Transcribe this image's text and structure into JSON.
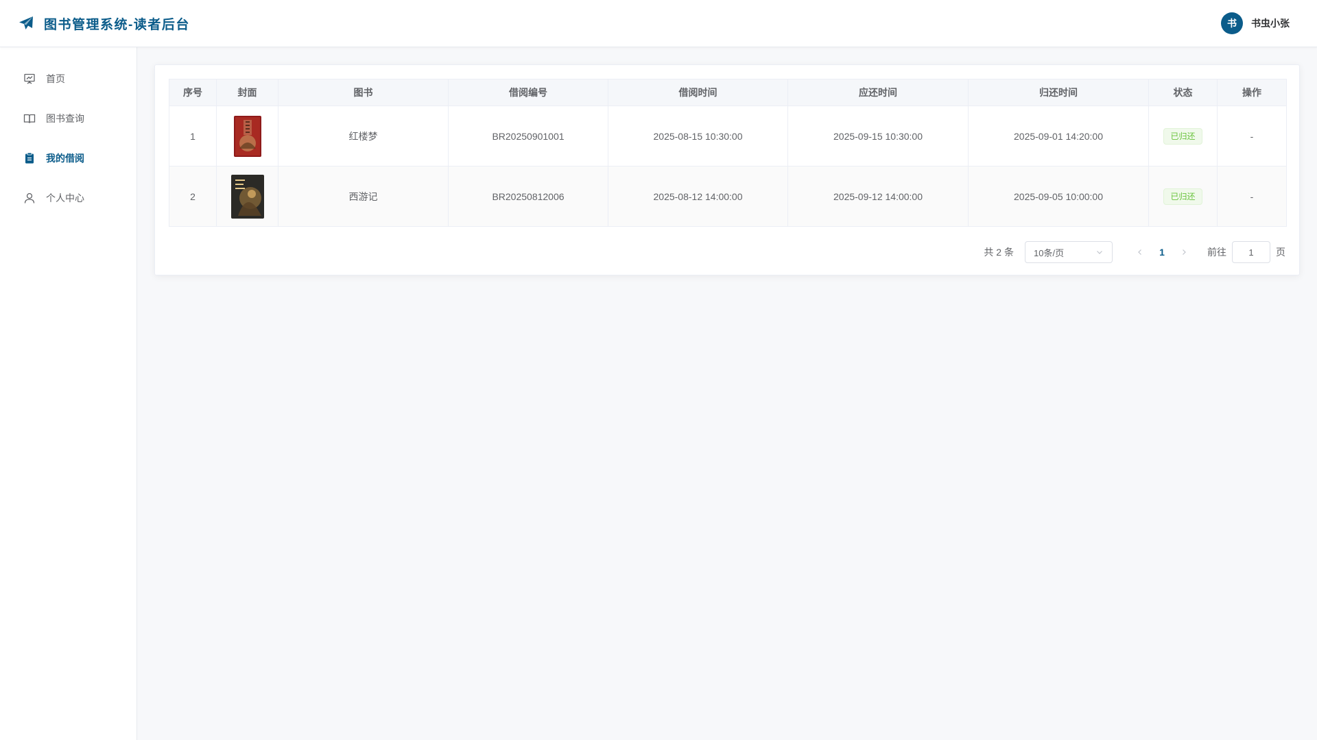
{
  "header": {
    "title": "图书管理系统-读者后台",
    "logo_icon": "paper-plane-icon",
    "user": {
      "avatar_text": "书",
      "name": "书虫小张"
    }
  },
  "sidebar": {
    "items": [
      {
        "label": "首页",
        "icon": "presentation-icon",
        "active": false
      },
      {
        "label": "图书查询",
        "icon": "book-open-icon",
        "active": false
      },
      {
        "label": "我的借阅",
        "icon": "clipboard-icon",
        "active": true
      },
      {
        "label": "个人中心",
        "icon": "user-icon",
        "active": false
      }
    ]
  },
  "table": {
    "columns": [
      "序号",
      "封面",
      "图书",
      "借阅编号",
      "借阅时间",
      "应还时间",
      "归还时间",
      "状态",
      "操作"
    ],
    "rows": [
      {
        "index": "1",
        "cover": "hongloumeng-cover",
        "book": "红楼梦",
        "borrow_id": "BR20250901001",
        "borrow_time": "2025-08-15 10:30:00",
        "due_time": "2025-09-15 10:30:00",
        "return_time": "2025-09-01 14:20:00",
        "status": "已归还",
        "action": "-"
      },
      {
        "index": "2",
        "cover": "xiyouji-cover",
        "book": "西游记",
        "borrow_id": "BR20250812006",
        "borrow_time": "2025-08-12 14:00:00",
        "due_time": "2025-09-12 14:00:00",
        "return_time": "2025-09-05 10:00:00",
        "status": "已归还",
        "action": "-"
      }
    ]
  },
  "pagination": {
    "total_label": "共 2 条",
    "page_size": "10条/页",
    "current_page": "1",
    "goto_label": "前往",
    "goto_value": "1",
    "page_suffix": "页"
  },
  "colors": {
    "brand": "#0b5c8a",
    "success": "#67c23a"
  }
}
